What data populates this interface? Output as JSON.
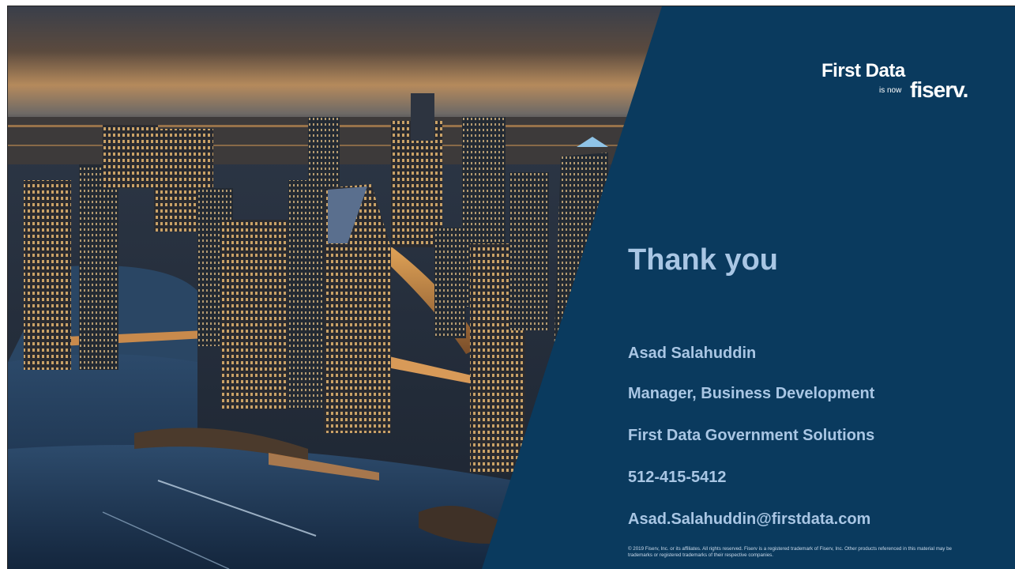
{
  "logo": {
    "first_data": "First Data",
    "is_now": "is now",
    "fiserv": "fiserv."
  },
  "title": "Thank you",
  "contact": {
    "name": "Asad Salahuddin",
    "role": "Manager, Business Development",
    "org": "First Data Government Solutions",
    "phone": "512-415-5412",
    "email": "Asad.Salahuddin@firstdata.com"
  },
  "footer": "© 2019 Fiserv, Inc. or its affiliates. All rights reserved. Fiserv is a registered trademark of Fiserv, Inc. Other products referenced in this material may be trademarks or registered trademarks of their respective companies.",
  "colors": {
    "panel_blue": "#0a3a5e",
    "title_text": "#a9c6e4"
  },
  "image": {
    "icon": "city-skyline-photo"
  }
}
